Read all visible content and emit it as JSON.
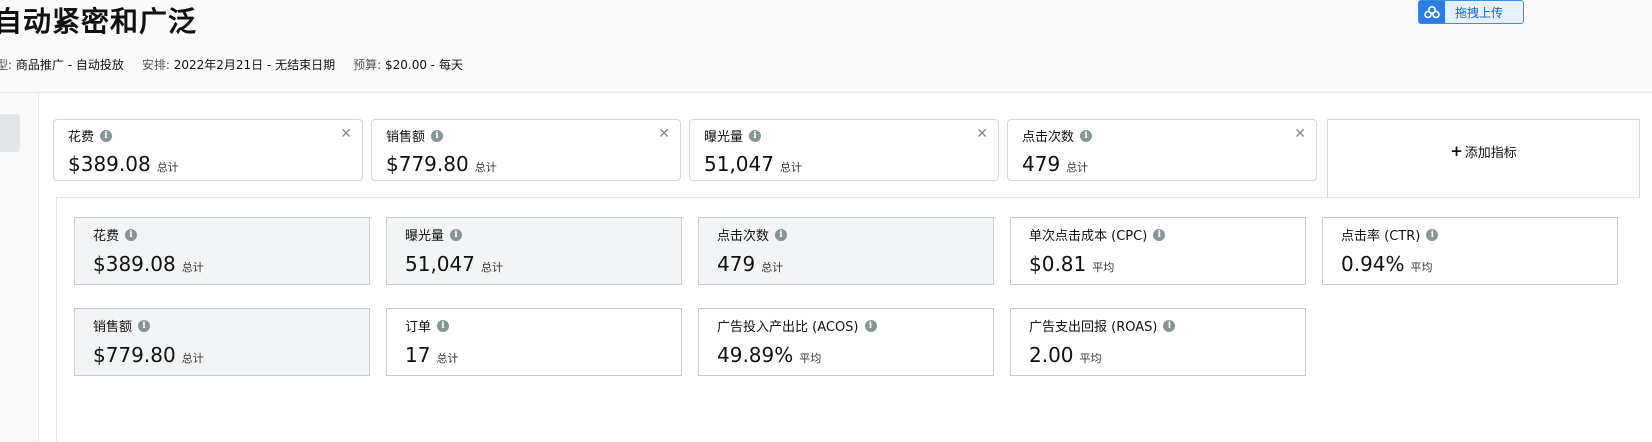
{
  "campaign": {
    "title": "自动紧密和广泛",
    "upload_label": "拖拽上传",
    "meta": [
      {
        "key": "型:",
        "value": "商品推广 - 自动投放"
      },
      {
        "key": "安排:",
        "value": "2022年2月21日 - 无结束日期"
      },
      {
        "key": "预算:",
        "value": "$20.00 - 每天"
      }
    ]
  },
  "selected_metrics": [
    {
      "label": "花费",
      "value": "$389.08",
      "unit": "总计"
    },
    {
      "label": "销售额",
      "value": "$779.80",
      "unit": "总计"
    },
    {
      "label": "曝光量",
      "value": "51,047",
      "unit": "总计"
    },
    {
      "label": "点击次数",
      "value": "479",
      "unit": "总计"
    }
  ],
  "add_metric_label": "添加指标",
  "metric_cards": [
    {
      "label": "花费",
      "value": "$389.08",
      "unit": "总计",
      "selected": true
    },
    {
      "label": "曝光量",
      "value": "51,047",
      "unit": "总计",
      "selected": true
    },
    {
      "label": "点击次数",
      "value": "479",
      "unit": "总计",
      "selected": true
    },
    {
      "label": "单次点击成本 (CPC)",
      "value": "$0.81",
      "unit": "平均",
      "selected": false
    },
    {
      "label": "点击率 (CTR)",
      "value": "0.94%",
      "unit": "平均",
      "selected": false
    },
    {
      "label": "销售额",
      "value": "$779.80",
      "unit": "总计",
      "selected": true
    },
    {
      "label": "订单",
      "value": "17",
      "unit": "总计",
      "selected": false
    },
    {
      "label": "广告投入产出比 (ACOS)",
      "value": "49.89%",
      "unit": "平均",
      "selected": false
    },
    {
      "label": "广告支出回报 (ROAS)",
      "value": "2.00",
      "unit": "平均",
      "selected": false
    }
  ],
  "icons": {
    "info": "info-icon",
    "close": "close-icon",
    "upload": "cloud-upload-icon",
    "plus": "plus-icon"
  },
  "colors": {
    "accent": "#2b7de0",
    "selected_card_bg": "#f3f4f5",
    "info_icon": "#879596"
  }
}
